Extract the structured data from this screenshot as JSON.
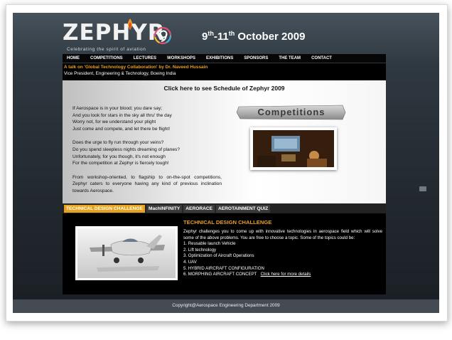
{
  "header": {
    "logo_text": "ZEPHYR",
    "logo_tagline": "Celebrating the spirit of aviation",
    "date_prefix": "9",
    "date_sup1": "th",
    "date_mid": "-11",
    "date_sup2": "th",
    "date_suffix": " October 2009"
  },
  "nav": {
    "items": [
      "HOME",
      "COMPETITIONS",
      "LECTURES",
      "WORKSHOPS",
      "EXHIBITIONS",
      "SPONSORS",
      "THE TEAM",
      "CONTACT"
    ]
  },
  "talk": {
    "line1": "A talk on 'Global Technology Collaboration' by Dr. Naveed Hussain",
    "line2": "Vice President, Engineering & Technology, Boeing India"
  },
  "main": {
    "schedule_link": "Click here to see Schedule of Zephyr 2009",
    "poem": [
      " If Aerospace is in your blood; you dare say;",
      "And you look for stars in the sky all thru' the day",
      "Worry not, for we understand your plight",
      "Just come and compete, and let there be flight!"
    ],
    "poem2": [
      "Does the urge to fly run through your veins?",
      "Do you spend sleepless nights dreaming of planes?",
      "Unfortunately, for you though, it's not enough",
      "For the competition at Zephyr is fiercely tough!"
    ],
    "intro": "From workshop-oriented, to flagship to on-the-spot competitions, Zephyr caters to everyone having any kind of previous inclination towards Aerospace.",
    "competitions_banner": "Competitions"
  },
  "tabs": [
    "TECHNICAL DESIGN CHALLENGE",
    "MachINFINITY",
    "AERORACE",
    "AEROTAINMENT QUIZ"
  ],
  "panel": {
    "title": "TECHNICAL DESIGN CHALLENGE",
    "body": "Zephyr challenges you to come up with innovative technologies in aerospace field which will solve some of the above problems. You are free to choose a topic. Some of the topics could be:",
    "topics": [
      "1. Reusable launch Vehicle",
      "2. Lift technology",
      "3. Optimization of Aircraft Operations",
      "4. UAV",
      "5. HYBRID AIRCRAFT CONFIGURATION",
      "6. MORPHING AIRCRAFT CONCEPT"
    ],
    "details_link": "Click here for more details"
  },
  "footer": {
    "copyright": "Copyright@Aerospace Engineering Department 2009"
  }
}
